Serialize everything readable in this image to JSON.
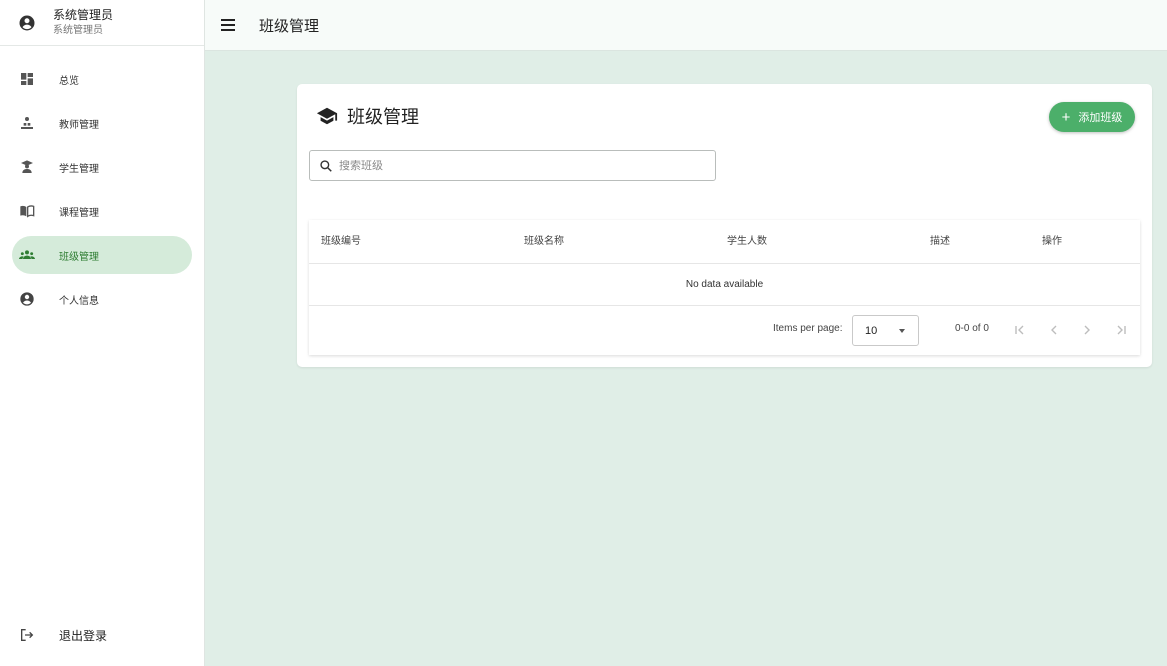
{
  "user": {
    "name": "系统管理员",
    "role": "系统管理员"
  },
  "sidebar": {
    "items": [
      {
        "label": "总览",
        "icon": "dashboard-icon"
      },
      {
        "label": "教师管理",
        "icon": "teacher-icon"
      },
      {
        "label": "学生管理",
        "icon": "student-icon"
      },
      {
        "label": "课程管理",
        "icon": "book-icon"
      },
      {
        "label": "班级管理",
        "icon": "groups-icon",
        "active": true
      },
      {
        "label": "个人信息",
        "icon": "account-circle-icon"
      }
    ],
    "logout_label": "退出登录"
  },
  "topbar": {
    "title": "班级管理"
  },
  "card": {
    "title": "班级管理",
    "add_button_label": "添加班级",
    "search_placeholder": "搜索班级"
  },
  "table": {
    "columns": [
      "班级编号",
      "班级名称",
      "学生人数",
      "描述",
      "操作"
    ],
    "empty_text": "No data available",
    "items_per_page_label": "Items per page:",
    "items_per_page_value": "10",
    "range_text": "0-0 of 0"
  },
  "colors": {
    "accent": "#4caf6a",
    "background": "#e0eee7",
    "active_nav": "#d5ebda"
  }
}
